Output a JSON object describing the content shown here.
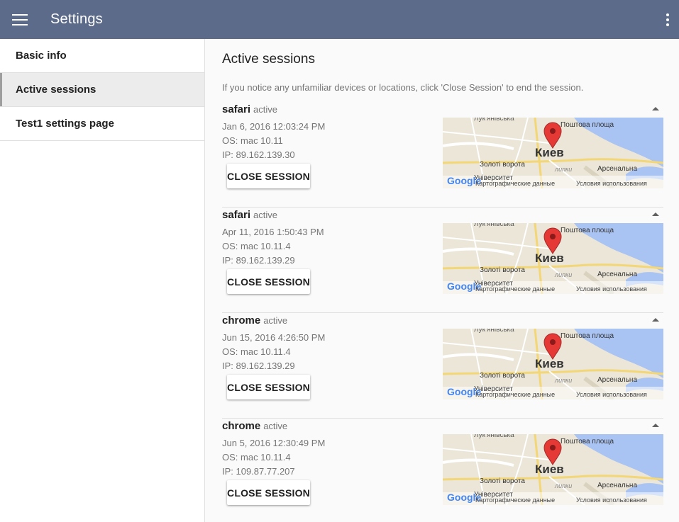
{
  "appbar": {
    "title": "Settings"
  },
  "sidebar": {
    "items": [
      {
        "label": "Basic info"
      },
      {
        "label": "Active sessions"
      },
      {
        "label": "Test1 settings page"
      }
    ]
  },
  "main": {
    "title": "Active sessions",
    "intro": "If you notice any unfamiliar devices or locations, click 'Close Session' to end the session.",
    "close_label": "CLOSE SESSION",
    "map": {
      "city": "Киев",
      "labels": [
        "Лук'янівська",
        "Поштова площа",
        "Золоті ворота",
        "Арсенальна",
        "Університет",
        "липки"
      ],
      "attribution": "Картографические данные",
      "terms": "Условия использования",
      "brand": "Google"
    },
    "sessions": [
      {
        "browser": "safari",
        "status": "active",
        "date": "Jan 6, 2016 12:03:24 PM",
        "os": "OS: mac 10.11",
        "ip": "IP: 89.162.139.30"
      },
      {
        "browser": "safari",
        "status": "active",
        "date": "Apr 11, 2016 1:50:43 PM",
        "os": "OS: mac 10.11.4",
        "ip": "IP: 89.162.139.29"
      },
      {
        "browser": "chrome",
        "status": "active",
        "date": "Jun 15, 2016 4:26:50 PM",
        "os": "OS: mac 10.11.4",
        "ip": "IP: 89.162.139.29"
      },
      {
        "browser": "chrome",
        "status": "active",
        "date": "Jun 5, 2016 12:30:49 PM",
        "os": "OS: mac 10.11.4",
        "ip": "IP: 109.87.77.207"
      }
    ]
  },
  "colors": {
    "appbar": "#5c6b8a",
    "water": "#a9c3f2",
    "land": "#ebe6d8",
    "pin": "#e53935"
  }
}
